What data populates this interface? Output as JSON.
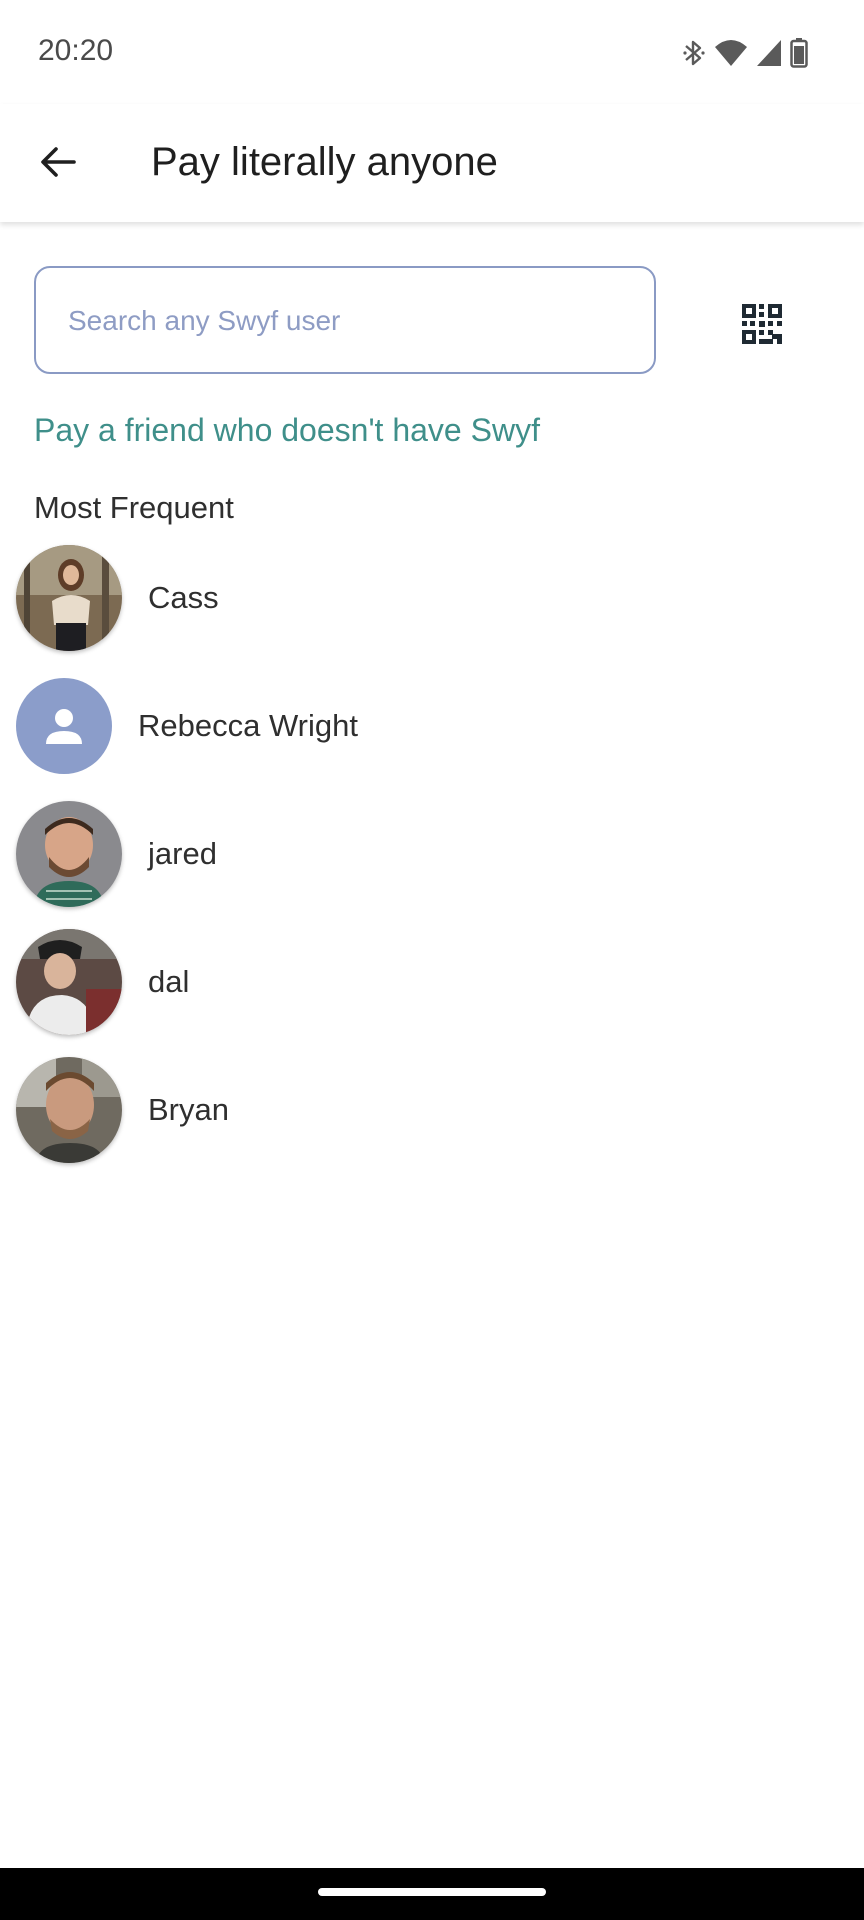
{
  "status_bar": {
    "time": "20:20",
    "icons": [
      "bluetooth-icon",
      "wifi-icon",
      "cellular-signal-icon",
      "battery-icon"
    ]
  },
  "app_bar": {
    "back_icon": "arrow-back-icon",
    "title": "Pay literally anyone"
  },
  "search": {
    "placeholder": "Search any Swyf user",
    "value": "",
    "qr_icon": "qr-code-icon"
  },
  "invite_link": "Pay a friend who doesn't have Swyf",
  "most_frequent": {
    "title": "Most Frequent",
    "contacts": [
      {
        "name": "Cass",
        "avatar": "photo"
      },
      {
        "name": "Rebecca Wright",
        "avatar": "default-person-icon"
      },
      {
        "name": "jared",
        "avatar": "photo"
      },
      {
        "name": "dal",
        "avatar": "photo"
      },
      {
        "name": "Bryan",
        "avatar": "photo"
      }
    ]
  },
  "colors": {
    "accent_teal": "#3f8f8a",
    "search_border": "#8a9ac4",
    "placeholder": "#8e9cc4",
    "default_avatar_bg": "#8b9dca"
  }
}
